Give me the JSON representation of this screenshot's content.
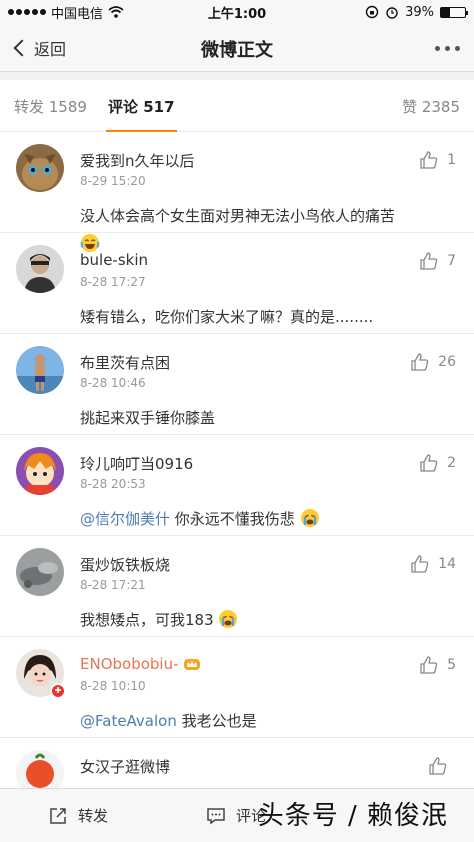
{
  "status_bar": {
    "carrier": "中国电信",
    "time": "上午1:00",
    "battery": "39%",
    "battery_level": 0.39
  },
  "nav": {
    "back_label": "返回",
    "title": "微博正文"
  },
  "tabs": {
    "reposts": "转发 1589",
    "comments": "评论 517",
    "likes": "赞 2385"
  },
  "comments": [
    {
      "name": "爱我到n久年以后",
      "time": "8-29 15:20",
      "text": "没人体会高个女生面对男神无法小鸟依人的痛苦",
      "likes": "1",
      "emoji": "laugh-cry"
    },
    {
      "name": "bule-skin",
      "time": "8-28 17:27",
      "text": "矮有错么，吃你们家大米了嘛？真的是........",
      "likes": "7"
    },
    {
      "name": "布里茨有点困",
      "time": "8-28 10:46",
      "text": "挑起来双手锤你膝盖",
      "likes": "26"
    },
    {
      "name": "玲儿响叮当0916",
      "time": "8-28 20:53",
      "mention": "@信尔伽美什",
      "text": " 你永远不懂我伤悲",
      "likes": "2",
      "emoji": "crying"
    },
    {
      "name": "蛋炒饭铁板烧",
      "time": "8-28 17:21",
      "text": "我想矮点，可我183",
      "likes": "14",
      "emoji": "crying"
    },
    {
      "name": "ENObobobiu-",
      "time": "8-28 10:10",
      "mention": "@FateAvalon",
      "text": " 我老公也是",
      "likes": "5",
      "vip": true
    },
    {
      "name": "女汉子逛微博",
      "likes": ""
    }
  ],
  "bottom_bar": {
    "repost": "转发",
    "comment": "评论",
    "watermark": "头条号 / 赖俊泯"
  },
  "colors": {
    "accent": "#ff8200",
    "mention": "#507daf",
    "vip_name": "#eb7350"
  }
}
